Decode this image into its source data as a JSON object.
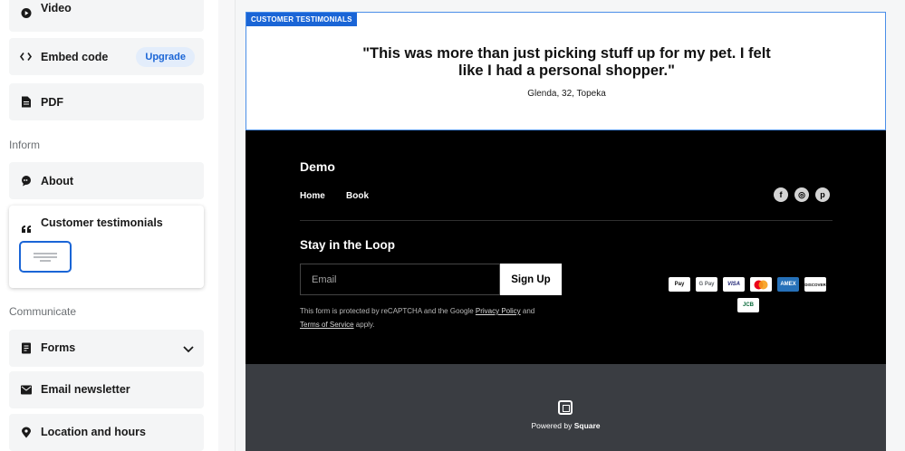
{
  "sidebar": {
    "items_top": [
      {
        "label": "Video",
        "icon": "play-circle-icon"
      },
      {
        "label": "Embed code",
        "icon": "code-icon",
        "badge": "Upgrade"
      },
      {
        "label": "PDF",
        "icon": "document-icon"
      }
    ],
    "section_inform": "Inform",
    "about": {
      "label": "About",
      "icon": "chat-bubble-icon"
    },
    "testimonials": {
      "label": "Customer testimonials",
      "icon": "quote-icon"
    },
    "section_communicate": "Communicate",
    "items_bottom": [
      {
        "label": "Forms",
        "icon": "form-icon"
      },
      {
        "label": "Email newsletter",
        "icon": "envelope-icon"
      },
      {
        "label": "Location and hours",
        "icon": "location-pin-icon"
      }
    ]
  },
  "testimonial": {
    "tag": "CUSTOMER TESTIMONIALS",
    "quote": "\"This was more than just picking stuff up for my pet. I felt like I had a personal shopper.\"",
    "author": "Glenda, 32, Topeka"
  },
  "footer": {
    "brand": "Demo",
    "nav": [
      "Home",
      "Book"
    ],
    "social": [
      {
        "icon": "facebook-icon",
        "glyph": "f"
      },
      {
        "icon": "instagram-icon",
        "glyph": "◎"
      },
      {
        "icon": "pinterest-icon",
        "glyph": "p"
      }
    ],
    "newsletter_title": "Stay in the Loop",
    "email_placeholder": "Email",
    "signup_label": "Sign Up",
    "fine_print_prefix": "This form is protected by reCAPTCHA and the Google ",
    "privacy_link": "Privacy Policy",
    "fine_print_and": " and",
    "terms_link": "Terms of Service",
    "fine_print_suffix": " apply.",
    "payments": [
      {
        "icon": "apple-pay-icon",
        "text": "Pay",
        "color": "#111111"
      },
      {
        "icon": "google-pay-icon",
        "text": "G Pay",
        "color": "#5f6368"
      },
      {
        "icon": "visa-icon",
        "text": "VISA",
        "color": "#1a1f71"
      },
      {
        "icon": "mastercard-icon",
        "text": "",
        "color": "#eb001b"
      },
      {
        "icon": "amex-icon",
        "text": "AMEX",
        "color": "#ffffff"
      },
      {
        "icon": "discover-icon",
        "text": "DISCOVER",
        "color": "#111111"
      },
      {
        "icon": "jcb-icon",
        "text": "JCB",
        "color": "#0a6a3a"
      }
    ]
  },
  "powered": {
    "prefix": "Powered by ",
    "brand": "Square"
  },
  "colors": {
    "accent": "#1a65d6",
    "footer_bg": "#000000",
    "bottom_bar": "#3a3d42"
  }
}
